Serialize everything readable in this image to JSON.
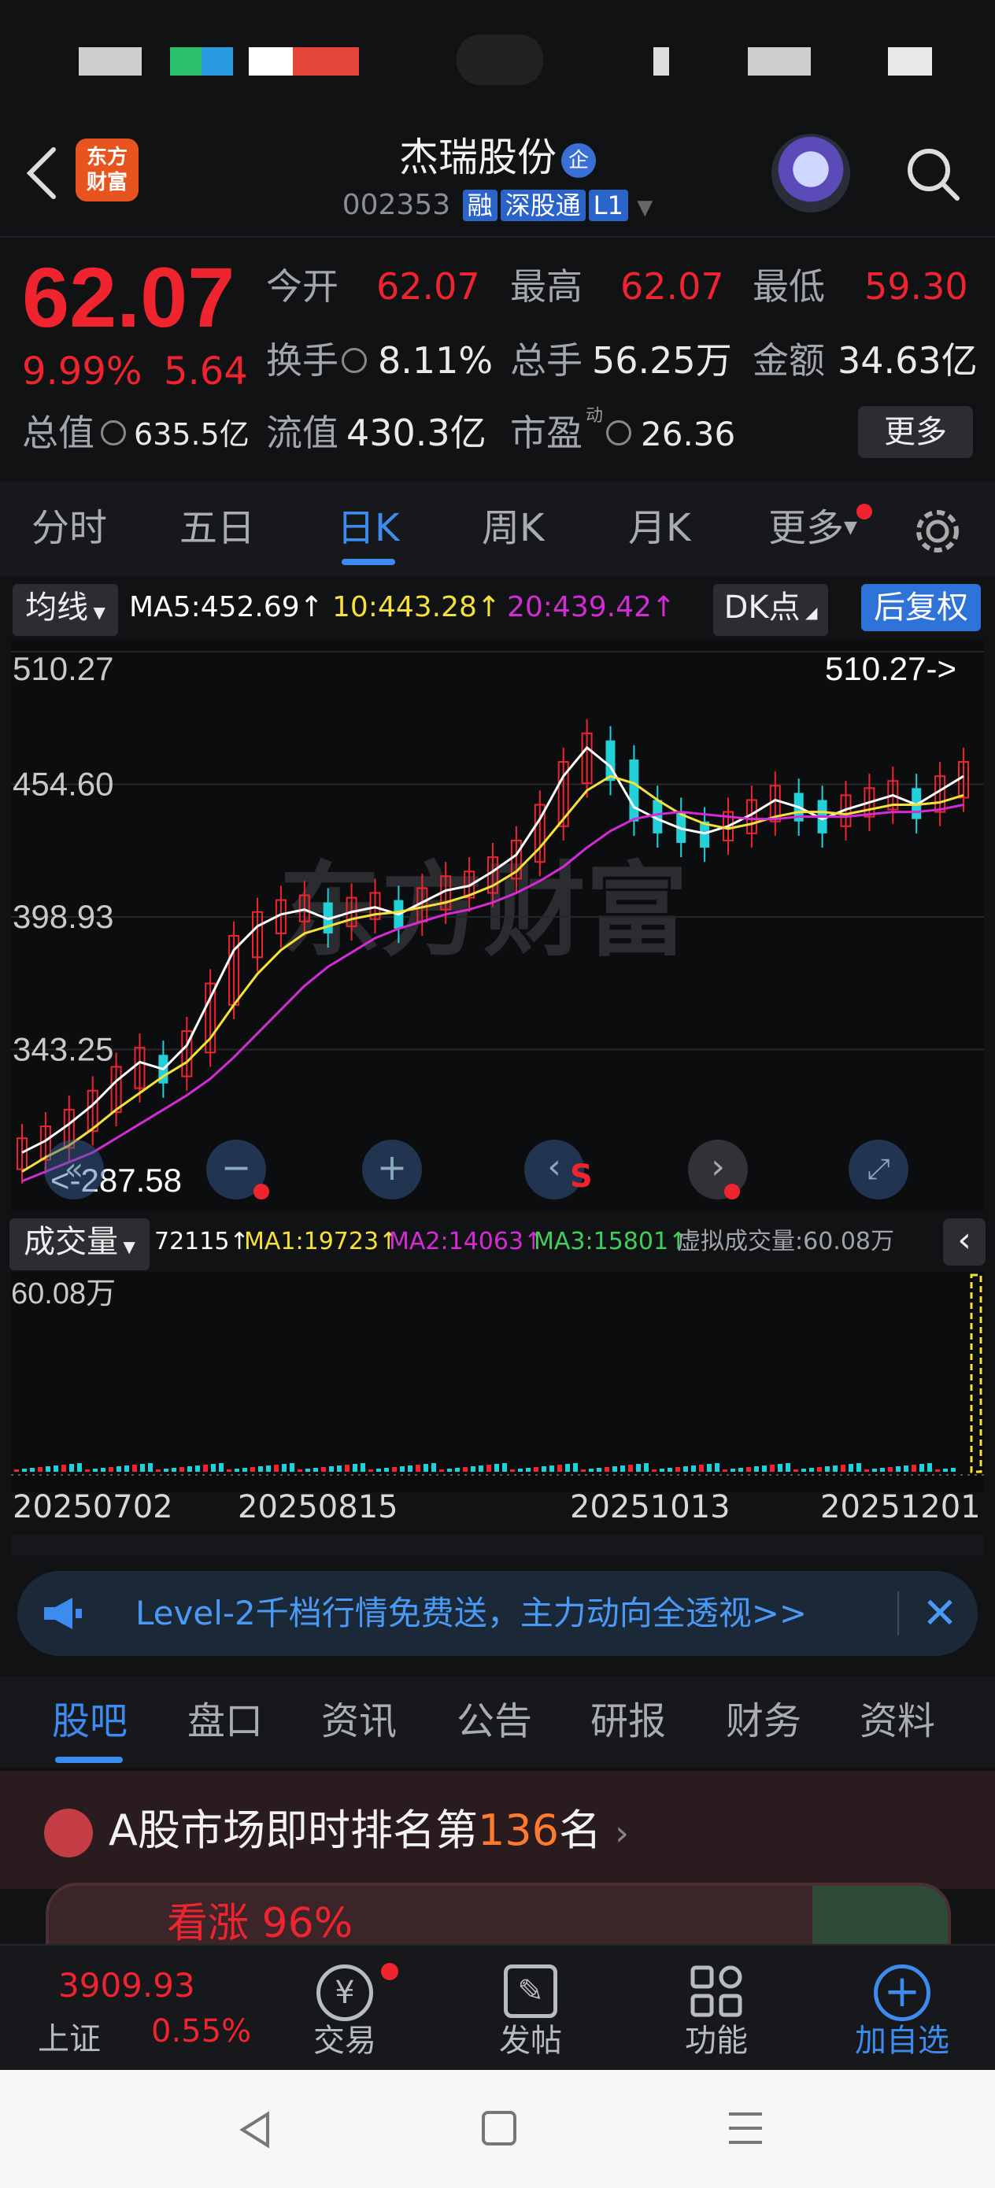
{
  "header": {
    "back_icon": "chevron-left-icon",
    "logo_text_line1": "东方",
    "logo_text_line2": "财富",
    "stock_name": "杰瑞股份",
    "stock_badge": "企",
    "stock_code": "002353",
    "tags": [
      "融",
      "深股通",
      "L1"
    ]
  },
  "quote": {
    "price": "62.07",
    "change_pct": "9.99%",
    "change_amt": "5.64",
    "open_label": "今开",
    "open_value": "62.07",
    "high_label": "最高",
    "high_value": "62.07",
    "low_label": "最低",
    "low_value": "59.30",
    "turnover_label": "换手",
    "turnover_value": "8.11%",
    "volume_label": "总手",
    "volume_value": "56.25万",
    "amount_label": "金额",
    "amount_value": "34.63亿",
    "mktcap_label": "总值",
    "mktcap_value": "635.5亿",
    "float_label": "流值",
    "float_value": "430.3亿",
    "pe_label": "市盈",
    "pe_sup": "动",
    "pe_value": "26.36",
    "more_label": "更多"
  },
  "tabs": [
    "分时",
    "五日",
    "日K",
    "周K",
    "月K",
    "更多"
  ],
  "active_tab": "日K",
  "ma_legend": {
    "select_label": "均线",
    "ma5": "MA5:452.69↑",
    "ma10": "10:443.28↑",
    "ma20": "20:439.42↑",
    "dk_label": "DK点",
    "adjust_label": "后复权"
  },
  "chart_data": {
    "type": "candlestick",
    "y_ticks": [
      "510.27",
      "454.60",
      "398.93",
      "343.25"
    ],
    "max_label": "510.27->",
    "min_label": "<-287.58",
    "x_ticks": [
      "20250702",
      "20250815",
      "20251013",
      "20251201"
    ],
    "ylim": [
      287.58,
      510.27
    ],
    "series": [
      {
        "values": [
          300,
          305,
          312,
          320,
          330,
          338,
          335,
          345,
          365,
          385,
          395,
          400,
          402,
          398,
          401,
          403,
          400,
          405,
          410,
          412,
          418,
          425,
          440,
          458,
          470,
          462,
          445,
          440,
          436,
          434,
          437,
          442,
          448,
          445,
          440,
          444,
          447,
          450,
          446,
          452,
          458
        ]
      },
      {
        "values": [
          292,
          298,
          303,
          310,
          318,
          325,
          332,
          338,
          348,
          362,
          375,
          385,
          392,
          395,
          398,
          400,
          401,
          403,
          405,
          408,
          412,
          418,
          428,
          440,
          452,
          458,
          455,
          448,
          442,
          438,
          436,
          438,
          441,
          443,
          443,
          442,
          444,
          446,
          446,
          447,
          450
        ]
      },
      {
        "values": [
          288,
          292,
          296,
          300,
          306,
          312,
          318,
          324,
          331,
          340,
          350,
          360,
          370,
          378,
          384,
          390,
          394,
          397,
          400,
          402,
          405,
          409,
          414,
          420,
          428,
          435,
          440,
          442,
          443,
          442,
          441,
          440,
          440,
          441,
          441,
          441,
          442,
          443,
          443,
          444,
          446
        ]
      }
    ]
  },
  "volume": {
    "select_label": "成交量",
    "vol": "72115↑",
    "ma1": "MA1:19723↑",
    "ma2": "MA2:14063↑",
    "ma3": "MA3:15801↑",
    "virtual": "虚拟成交量:60.08万",
    "max_label": "60.08万"
  },
  "banner": {
    "text": "Level-2千档行情免费送，主力动向全透视>>"
  },
  "section_tabs": [
    "股吧",
    "盘口",
    "资讯",
    "公告",
    "研报",
    "财务",
    "资料"
  ],
  "active_section": "股吧",
  "rank": {
    "prefix": "A股市场即时排名第",
    "number": "136",
    "suffix": "名"
  },
  "partial_card": "看涨 96%",
  "bottom_bar": {
    "index_value": "3909.93",
    "index_name": "上证",
    "index_change": "0.55%",
    "items": [
      "交易",
      "发帖",
      "功能",
      "加自选"
    ]
  },
  "colors": {
    "up": "#f0242f",
    "down": "#21d0d8",
    "ma5": "#ffffff",
    "ma10": "#f5e13a",
    "ma20": "#d42bd6",
    "accent": "#3c8cf0"
  }
}
